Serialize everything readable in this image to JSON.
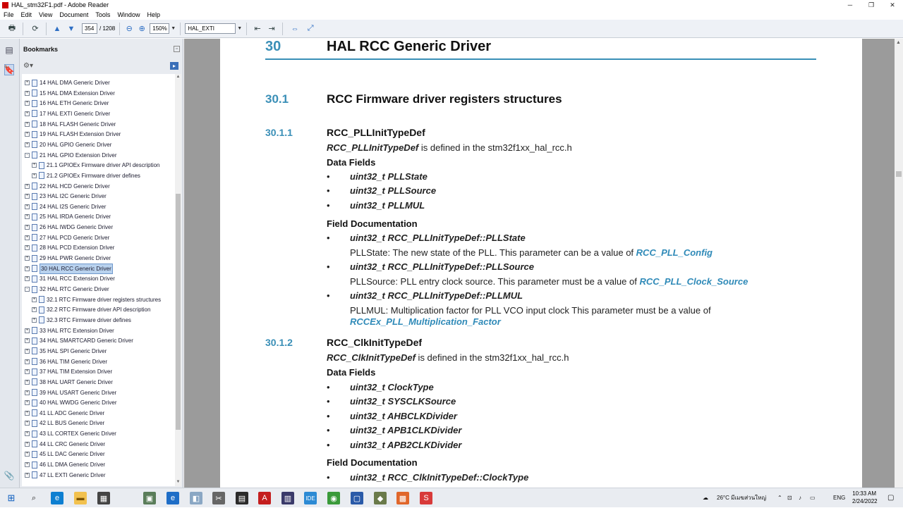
{
  "window": {
    "title": "HAL_stm32F1.pdf - Adobe Reader"
  },
  "menu": [
    "File",
    "Edit",
    "View",
    "Document",
    "Tools",
    "Window",
    "Help"
  ],
  "toolbar": {
    "page_current": "354",
    "page_total": "/ 1208",
    "zoom": "150%",
    "find_text": "HAL_EXTI"
  },
  "bookmarks": {
    "header": "Bookmarks",
    "items": [
      {
        "label": "14 HAL DMA Generic Driver",
        "level": 0,
        "pm": "+"
      },
      {
        "label": "15 HAL DMA Extension Driver",
        "level": 0,
        "pm": "+"
      },
      {
        "label": "16 HAL ETH Generic Driver",
        "level": 0,
        "pm": "+"
      },
      {
        "label": "17 HAL EXTI Generic Driver",
        "level": 0,
        "pm": "+"
      },
      {
        "label": "18 HAL FLASH Generic Driver",
        "level": 0,
        "pm": "+"
      },
      {
        "label": "19 HAL FLASH Extension Driver",
        "level": 0,
        "pm": "+"
      },
      {
        "label": "20 HAL GPIO Generic Driver",
        "level": 0,
        "pm": "+"
      },
      {
        "label": "21 HAL GPIO Extension Driver",
        "level": 0,
        "pm": "-"
      },
      {
        "label": "21.1 GPIOEx Firmware driver API description",
        "level": 1,
        "pm": "+"
      },
      {
        "label": "21.2 GPIOEx Firmware driver defines",
        "level": 1,
        "pm": "+"
      },
      {
        "label": "22 HAL HCD Generic Driver",
        "level": 0,
        "pm": "+"
      },
      {
        "label": "23 HAL I2C Generic Driver",
        "level": 0,
        "pm": "+"
      },
      {
        "label": "24 HAL I2S Generic Driver",
        "level": 0,
        "pm": "+"
      },
      {
        "label": "25 HAL IRDA Generic Driver",
        "level": 0,
        "pm": "+"
      },
      {
        "label": "26 HAL IWDG Generic Driver",
        "level": 0,
        "pm": "+"
      },
      {
        "label": "27 HAL PCD Generic Driver",
        "level": 0,
        "pm": "+"
      },
      {
        "label": "28 HAL PCD Extension Driver",
        "level": 0,
        "pm": "+"
      },
      {
        "label": "29 HAL PWR Generic Driver",
        "level": 0,
        "pm": "+"
      },
      {
        "label": "30 HAL RCC Generic Driver",
        "level": 0,
        "pm": "+",
        "selected": true
      },
      {
        "label": "31 HAL RCC Extension Driver",
        "level": 0,
        "pm": "+"
      },
      {
        "label": "32 HAL RTC Generic Driver",
        "level": 0,
        "pm": "-"
      },
      {
        "label": "32.1 RTC Firmware driver registers structures",
        "level": 1,
        "pm": "+"
      },
      {
        "label": "32.2 RTC Firmware driver API description",
        "level": 1,
        "pm": "+"
      },
      {
        "label": "32.3 RTC Firmware driver defines",
        "level": 1,
        "pm": "+"
      },
      {
        "label": "33 HAL RTC Extension Driver",
        "level": 0,
        "pm": "+"
      },
      {
        "label": "34 HAL SMARTCARD Generic Driver",
        "level": 0,
        "pm": "+"
      },
      {
        "label": "35 HAL SPI Generic Driver",
        "level": 0,
        "pm": "+"
      },
      {
        "label": "36 HAL TIM Generic Driver",
        "level": 0,
        "pm": "+"
      },
      {
        "label": "37 HAL TIM Extension Driver",
        "level": 0,
        "pm": "+"
      },
      {
        "label": "38 HAL UART Generic Driver",
        "level": 0,
        "pm": "+"
      },
      {
        "label": "39 HAL USART Generic Driver",
        "level": 0,
        "pm": "+"
      },
      {
        "label": "40 HAL WWDG Generic Driver",
        "level": 0,
        "pm": "+"
      },
      {
        "label": "41 LL ADC Generic Driver",
        "level": 0,
        "pm": "+"
      },
      {
        "label": "42 LL BUS Generic Driver",
        "level": 0,
        "pm": "+"
      },
      {
        "label": "43 LL CORTEX Generic Driver",
        "level": 0,
        "pm": "+"
      },
      {
        "label": "44 LL CRC Generic Driver",
        "level": 0,
        "pm": "+"
      },
      {
        "label": "45 LL DAC Generic Driver",
        "level": 0,
        "pm": "+"
      },
      {
        "label": "46 LL DMA Generic Driver",
        "level": 0,
        "pm": "+"
      },
      {
        "label": "47 LL EXTI Generic Driver",
        "level": 0,
        "pm": "+"
      }
    ]
  },
  "doc": {
    "chapter_num": "30",
    "chapter_title": "HAL RCC Generic Driver",
    "sec_num": "30.1",
    "sec_title": "RCC Firmware driver registers structures",
    "s1_num": "30.1.1",
    "s1_title": "RCC_PLLInitTypeDef",
    "s1_def_name": "RCC_PLLInitTypeDef",
    "s1_def_rest": " is defined in the stm32f1xx_hal_rcc.h",
    "data_fields": "Data Fields",
    "field_doc": "Field Documentation",
    "s1_fields": [
      "uint32_t PLLState",
      "uint32_t PLLSource",
      "uint32_t PLLMUL"
    ],
    "s1_doc1_title": "uint32_t RCC_PLLInitTypeDef::PLLState",
    "s1_doc1_text": "PLLState: The new state of the PLL. This parameter can be a value of ",
    "s1_doc1_link": "RCC_PLL_Config",
    "s1_doc2_title": "uint32_t RCC_PLLInitTypeDef::PLLSource",
    "s1_doc2_text": "PLLSource: PLL entry clock source. This parameter must be a value of ",
    "s1_doc2_link": "RCC_PLL_Clock_Source",
    "s1_doc3_title": "uint32_t RCC_PLLInitTypeDef::PLLMUL",
    "s1_doc3_text": "PLLMUL: Multiplication factor for PLL VCO input clock This parameter must be a value of",
    "s1_doc3_link": "RCCEx_PLL_Multiplication_Factor",
    "s2_num": "30.1.2",
    "s2_title": "RCC_ClkInitTypeDef",
    "s2_def_name": "RCC_ClkInitTypeDef",
    "s2_def_rest": " is defined in the stm32f1xx_hal_rcc.h",
    "s2_fields": [
      "uint32_t ClockType",
      "uint32_t SYSCLKSource",
      "uint32_t AHBCLKDivider",
      "uint32_t APB1CLKDivider",
      "uint32_t APB2CLKDivider"
    ],
    "s2_doc1_title": "uint32_t RCC_ClkInitTypeDef::ClockType",
    "bullet": "•"
  },
  "taskbar": {
    "weather": "26°C มีเมฆส่วนใหญ่",
    "lang": "ENG",
    "time": "10:33 AM",
    "date": "2/24/2022"
  }
}
